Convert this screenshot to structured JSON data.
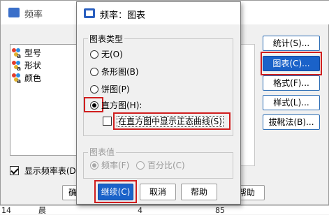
{
  "background_sheet": {
    "row_cells": [
      "14",
      "晨",
      "4",
      "85"
    ]
  },
  "freq_dialog": {
    "title": "频率",
    "variables": [
      {
        "label": "型号",
        "icon": "nominal-variable-icon"
      },
      {
        "label": "形状",
        "icon": "nominal-variable-icon"
      },
      {
        "label": "颜色",
        "icon": "nominal-variable-icon"
      }
    ],
    "side_buttons": [
      "统计(S)...",
      "图表(C)...",
      "格式(F)...",
      "样式(L)...",
      "拔靴法(B)..."
    ],
    "show_table_label": "显示频率表(D",
    "bottom_buttons": {
      "ok_partial": "确",
      "help_partial": "帮助"
    }
  },
  "chart_dialog": {
    "title": "频率：图表",
    "chart_type_group": {
      "label": "图表类型",
      "options": [
        "无(O)",
        "条形图(B)",
        "饼图(P)",
        "直方图(H):"
      ],
      "selected_index": 3,
      "normal_curve_label": "在直方图中显示正态曲线(S)",
      "normal_curve_checked": false
    },
    "chart_values_group": {
      "label": "图表值",
      "options": [
        "频率(F)",
        "百分比(C)"
      ],
      "selected_index": 0,
      "disabled": true
    },
    "buttons": {
      "continue": "继续(C)",
      "cancel": "取消",
      "help": "帮助"
    }
  }
}
